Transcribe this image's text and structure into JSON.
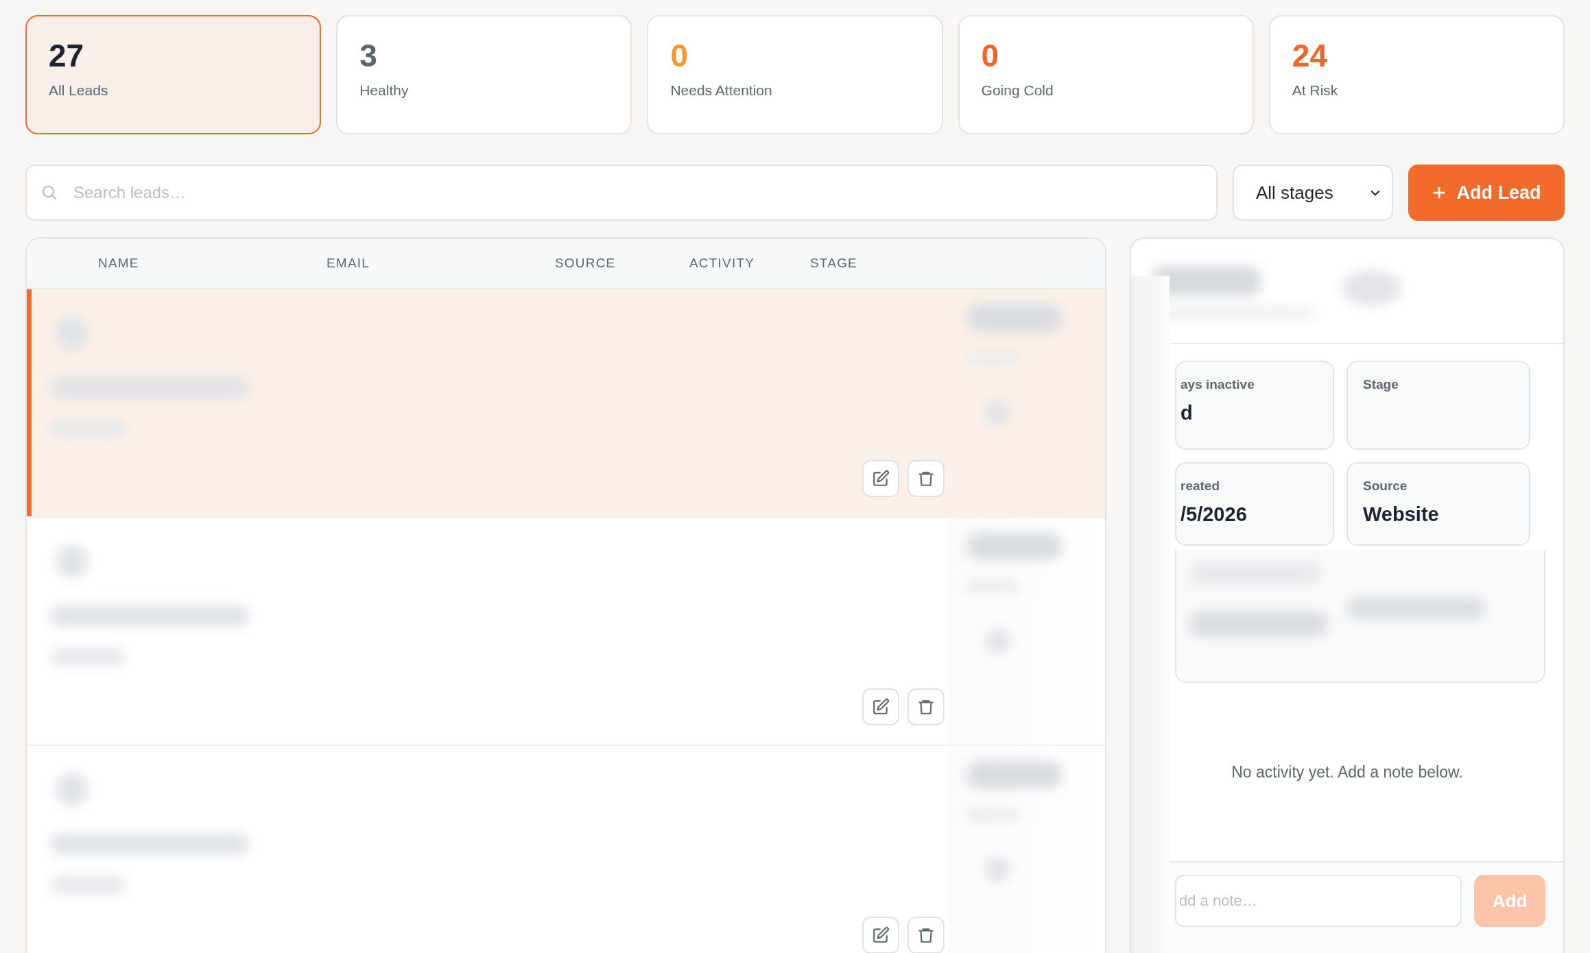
{
  "stats": [
    {
      "value": "27",
      "label": "All Leads",
      "color": "#1e2330",
      "selected": true
    },
    {
      "value": "3",
      "label": "Healthy",
      "color": "#5b6670",
      "selected": false
    },
    {
      "value": "0",
      "label": "Needs Attention",
      "color": "#f59a2e",
      "selected": false
    },
    {
      "value": "0",
      "label": "Going Cold",
      "color": "#f2652a",
      "selected": false
    },
    {
      "value": "24",
      "label": "At Risk",
      "color": "#f2652a",
      "selected": false
    }
  ],
  "search": {
    "placeholder": "Search leads…"
  },
  "stage_filter": {
    "value": "All stages"
  },
  "add_lead_button": {
    "label": "Add Lead"
  },
  "table": {
    "columns": [
      "NAME",
      "EMAIL",
      "SOURCE",
      "ACTIVITY",
      "STAGE"
    ],
    "rows": [
      {
        "selected": true
      },
      {
        "selected": false
      },
      {
        "selected": false
      }
    ]
  },
  "detail": {
    "fields": [
      {
        "label": "ays inactive",
        "value": "d"
      },
      {
        "label": "Stage"
      },
      {
        "label": "reated",
        "value": "/5/2026"
      },
      {
        "label": "Source",
        "value": "Website"
      }
    ],
    "empty_message": "No activity yet. Add a note below.",
    "note": {
      "placeholder": "dd a note…"
    },
    "add_button": {
      "label": "Add",
      "disabled": true
    }
  }
}
